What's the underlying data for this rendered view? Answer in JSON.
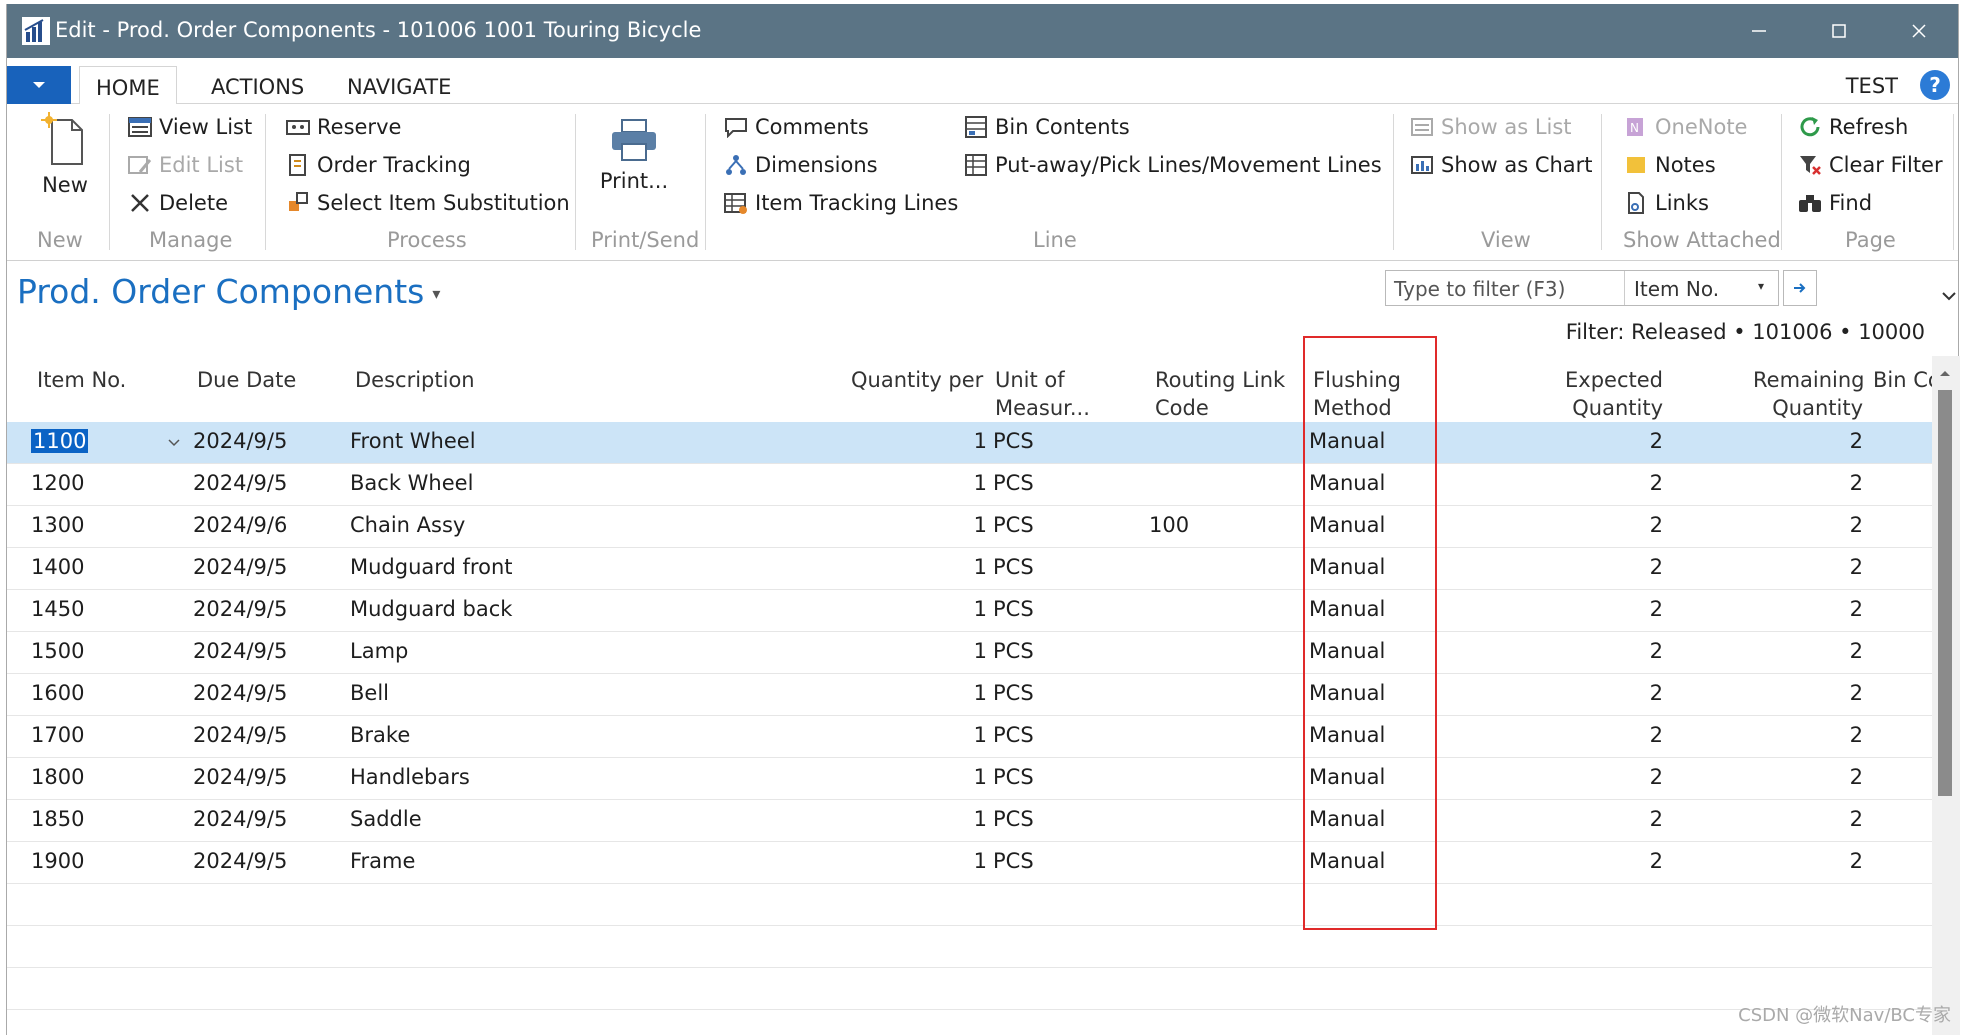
{
  "window": {
    "title": "Edit - Prod. Order Components - 101006 1001 Touring Bicycle"
  },
  "ribbon_tabs": [
    "HOME",
    "ACTIONS",
    "NAVIGATE"
  ],
  "user": "TEST",
  "help_label": "?",
  "ribbon": {
    "new": {
      "label": "New",
      "group": "New"
    },
    "manage": {
      "items": [
        "View List",
        "Edit List",
        "Delete"
      ],
      "group": "Manage"
    },
    "process": {
      "items": [
        "Reserve",
        "Order Tracking",
        "Select Item Substitution"
      ],
      "group": "Process"
    },
    "print": {
      "label": "Print...",
      "group": "Print/Send"
    },
    "line": {
      "items": [
        "Comments",
        "Dimensions",
        "Item Tracking Lines",
        "Bin Contents",
        "Put-away/Pick Lines/Movement Lines"
      ],
      "group": "Line"
    },
    "view": {
      "items": [
        "Show as List",
        "Show as Chart"
      ],
      "group": "View"
    },
    "show_attached": {
      "items": [
        "OneNote",
        "Notes",
        "Links"
      ],
      "group": "Show Attached"
    },
    "page": {
      "items": [
        "Refresh",
        "Clear Filter",
        "Find"
      ],
      "group": "Page"
    }
  },
  "page": {
    "title": "Prod. Order Components",
    "filter_placeholder": "Type to filter (F3)",
    "filter_field": "Item No.",
    "filter_text": "Filter: Released • 101006 • 10000"
  },
  "columns": {
    "item_no": "Item No.",
    "due_date": "Due Date",
    "description": "Description",
    "qty_per": "Quantity per",
    "uom_1": "Unit of",
    "uom_2": "Measur...",
    "routing_1": "Routing Link",
    "routing_2": "Code",
    "flushing_1": "Flushing",
    "flushing_2": "Method",
    "expected_1": "Expected",
    "expected_2": "Quantity",
    "remaining_1": "Remaining",
    "remaining_2": "Quantity",
    "bin": "Bin Co"
  },
  "rows": [
    {
      "item_no": "1100",
      "due_date": "2024/9/5",
      "description": "Front Wheel",
      "qty_per": "1",
      "uom": "PCS",
      "routing": "",
      "flushing": "Manual",
      "expected": "2",
      "remaining": "2"
    },
    {
      "item_no": "1200",
      "due_date": "2024/9/5",
      "description": "Back Wheel",
      "qty_per": "1",
      "uom": "PCS",
      "routing": "",
      "flushing": "Manual",
      "expected": "2",
      "remaining": "2"
    },
    {
      "item_no": "1300",
      "due_date": "2024/9/6",
      "description": "Chain Assy",
      "qty_per": "1",
      "uom": "PCS",
      "routing": "100",
      "flushing": "Manual",
      "expected": "2",
      "remaining": "2"
    },
    {
      "item_no": "1400",
      "due_date": "2024/9/5",
      "description": "Mudguard front",
      "qty_per": "1",
      "uom": "PCS",
      "routing": "",
      "flushing": "Manual",
      "expected": "2",
      "remaining": "2"
    },
    {
      "item_no": "1450",
      "due_date": "2024/9/5",
      "description": "Mudguard back",
      "qty_per": "1",
      "uom": "PCS",
      "routing": "",
      "flushing": "Manual",
      "expected": "2",
      "remaining": "2"
    },
    {
      "item_no": "1500",
      "due_date": "2024/9/5",
      "description": "Lamp",
      "qty_per": "1",
      "uom": "PCS",
      "routing": "",
      "flushing": "Manual",
      "expected": "2",
      "remaining": "2"
    },
    {
      "item_no": "1600",
      "due_date": "2024/9/5",
      "description": "Bell",
      "qty_per": "1",
      "uom": "PCS",
      "routing": "",
      "flushing": "Manual",
      "expected": "2",
      "remaining": "2"
    },
    {
      "item_no": "1700",
      "due_date": "2024/9/5",
      "description": "Brake",
      "qty_per": "1",
      "uom": "PCS",
      "routing": "",
      "flushing": "Manual",
      "expected": "2",
      "remaining": "2"
    },
    {
      "item_no": "1800",
      "due_date": "2024/9/5",
      "description": "Handlebars",
      "qty_per": "1",
      "uom": "PCS",
      "routing": "",
      "flushing": "Manual",
      "expected": "2",
      "remaining": "2"
    },
    {
      "item_no": "1850",
      "due_date": "2024/9/5",
      "description": "Saddle",
      "qty_per": "1",
      "uom": "PCS",
      "routing": "",
      "flushing": "Manual",
      "expected": "2",
      "remaining": "2"
    },
    {
      "item_no": "1900",
      "due_date": "2024/9/5",
      "description": "Frame",
      "qty_per": "1",
      "uom": "PCS",
      "routing": "",
      "flushing": "Manual",
      "expected": "2",
      "remaining": "2"
    }
  ],
  "watermark": "CSDN @微软Nav/BC专家",
  "colors": {
    "titlebar": "#5b7485",
    "accent": "#1a6fc1",
    "selection": "#cce4f7",
    "highlight": "#e02a2a"
  }
}
